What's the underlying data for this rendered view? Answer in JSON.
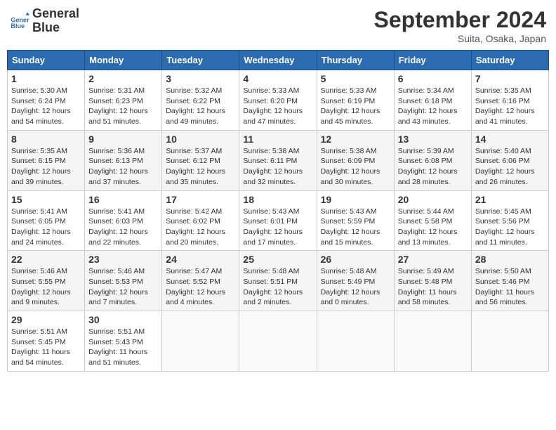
{
  "logo": {
    "line1": "General",
    "line2": "Blue"
  },
  "title": "September 2024",
  "subtitle": "Suita, Osaka, Japan",
  "weekdays": [
    "Sunday",
    "Monday",
    "Tuesday",
    "Wednesday",
    "Thursday",
    "Friday",
    "Saturday"
  ],
  "weeks": [
    [
      {
        "day": "1",
        "lines": [
          "Sunrise: 5:30 AM",
          "Sunset: 6:24 PM",
          "Daylight: 12 hours",
          "and 54 minutes."
        ]
      },
      {
        "day": "2",
        "lines": [
          "Sunrise: 5:31 AM",
          "Sunset: 6:23 PM",
          "Daylight: 12 hours",
          "and 51 minutes."
        ]
      },
      {
        "day": "3",
        "lines": [
          "Sunrise: 5:32 AM",
          "Sunset: 6:22 PM",
          "Daylight: 12 hours",
          "and 49 minutes."
        ]
      },
      {
        "day": "4",
        "lines": [
          "Sunrise: 5:33 AM",
          "Sunset: 6:20 PM",
          "Daylight: 12 hours",
          "and 47 minutes."
        ]
      },
      {
        "day": "5",
        "lines": [
          "Sunrise: 5:33 AM",
          "Sunset: 6:19 PM",
          "Daylight: 12 hours",
          "and 45 minutes."
        ]
      },
      {
        "day": "6",
        "lines": [
          "Sunrise: 5:34 AM",
          "Sunset: 6:18 PM",
          "Daylight: 12 hours",
          "and 43 minutes."
        ]
      },
      {
        "day": "7",
        "lines": [
          "Sunrise: 5:35 AM",
          "Sunset: 6:16 PM",
          "Daylight: 12 hours",
          "and 41 minutes."
        ]
      }
    ],
    [
      {
        "day": "8",
        "lines": [
          "Sunrise: 5:35 AM",
          "Sunset: 6:15 PM",
          "Daylight: 12 hours",
          "and 39 minutes."
        ]
      },
      {
        "day": "9",
        "lines": [
          "Sunrise: 5:36 AM",
          "Sunset: 6:13 PM",
          "Daylight: 12 hours",
          "and 37 minutes."
        ]
      },
      {
        "day": "10",
        "lines": [
          "Sunrise: 5:37 AM",
          "Sunset: 6:12 PM",
          "Daylight: 12 hours",
          "and 35 minutes."
        ]
      },
      {
        "day": "11",
        "lines": [
          "Sunrise: 5:38 AM",
          "Sunset: 6:11 PM",
          "Daylight: 12 hours",
          "and 32 minutes."
        ]
      },
      {
        "day": "12",
        "lines": [
          "Sunrise: 5:38 AM",
          "Sunset: 6:09 PM",
          "Daylight: 12 hours",
          "and 30 minutes."
        ]
      },
      {
        "day": "13",
        "lines": [
          "Sunrise: 5:39 AM",
          "Sunset: 6:08 PM",
          "Daylight: 12 hours",
          "and 28 minutes."
        ]
      },
      {
        "day": "14",
        "lines": [
          "Sunrise: 5:40 AM",
          "Sunset: 6:06 PM",
          "Daylight: 12 hours",
          "and 26 minutes."
        ]
      }
    ],
    [
      {
        "day": "15",
        "lines": [
          "Sunrise: 5:41 AM",
          "Sunset: 6:05 PM",
          "Daylight: 12 hours",
          "and 24 minutes."
        ]
      },
      {
        "day": "16",
        "lines": [
          "Sunrise: 5:41 AM",
          "Sunset: 6:03 PM",
          "Daylight: 12 hours",
          "and 22 minutes."
        ]
      },
      {
        "day": "17",
        "lines": [
          "Sunrise: 5:42 AM",
          "Sunset: 6:02 PM",
          "Daylight: 12 hours",
          "and 20 minutes."
        ]
      },
      {
        "day": "18",
        "lines": [
          "Sunrise: 5:43 AM",
          "Sunset: 6:01 PM",
          "Daylight: 12 hours",
          "and 17 minutes."
        ]
      },
      {
        "day": "19",
        "lines": [
          "Sunrise: 5:43 AM",
          "Sunset: 5:59 PM",
          "Daylight: 12 hours",
          "and 15 minutes."
        ]
      },
      {
        "day": "20",
        "lines": [
          "Sunrise: 5:44 AM",
          "Sunset: 5:58 PM",
          "Daylight: 12 hours",
          "and 13 minutes."
        ]
      },
      {
        "day": "21",
        "lines": [
          "Sunrise: 5:45 AM",
          "Sunset: 5:56 PM",
          "Daylight: 12 hours",
          "and 11 minutes."
        ]
      }
    ],
    [
      {
        "day": "22",
        "lines": [
          "Sunrise: 5:46 AM",
          "Sunset: 5:55 PM",
          "Daylight: 12 hours",
          "and 9 minutes."
        ]
      },
      {
        "day": "23",
        "lines": [
          "Sunrise: 5:46 AM",
          "Sunset: 5:53 PM",
          "Daylight: 12 hours",
          "and 7 minutes."
        ]
      },
      {
        "day": "24",
        "lines": [
          "Sunrise: 5:47 AM",
          "Sunset: 5:52 PM",
          "Daylight: 12 hours",
          "and 4 minutes."
        ]
      },
      {
        "day": "25",
        "lines": [
          "Sunrise: 5:48 AM",
          "Sunset: 5:51 PM",
          "Daylight: 12 hours",
          "and 2 minutes."
        ]
      },
      {
        "day": "26",
        "lines": [
          "Sunrise: 5:48 AM",
          "Sunset: 5:49 PM",
          "Daylight: 12 hours",
          "and 0 minutes."
        ]
      },
      {
        "day": "27",
        "lines": [
          "Sunrise: 5:49 AM",
          "Sunset: 5:48 PM",
          "Daylight: 11 hours",
          "and 58 minutes."
        ]
      },
      {
        "day": "28",
        "lines": [
          "Sunrise: 5:50 AM",
          "Sunset: 5:46 PM",
          "Daylight: 11 hours",
          "and 56 minutes."
        ]
      }
    ],
    [
      {
        "day": "29",
        "lines": [
          "Sunrise: 5:51 AM",
          "Sunset: 5:45 PM",
          "Daylight: 11 hours",
          "and 54 minutes."
        ]
      },
      {
        "day": "30",
        "lines": [
          "Sunrise: 5:51 AM",
          "Sunset: 5:43 PM",
          "Daylight: 11 hours",
          "and 51 minutes."
        ]
      },
      {
        "day": "",
        "lines": []
      },
      {
        "day": "",
        "lines": []
      },
      {
        "day": "",
        "lines": []
      },
      {
        "day": "",
        "lines": []
      },
      {
        "day": "",
        "lines": []
      }
    ]
  ]
}
